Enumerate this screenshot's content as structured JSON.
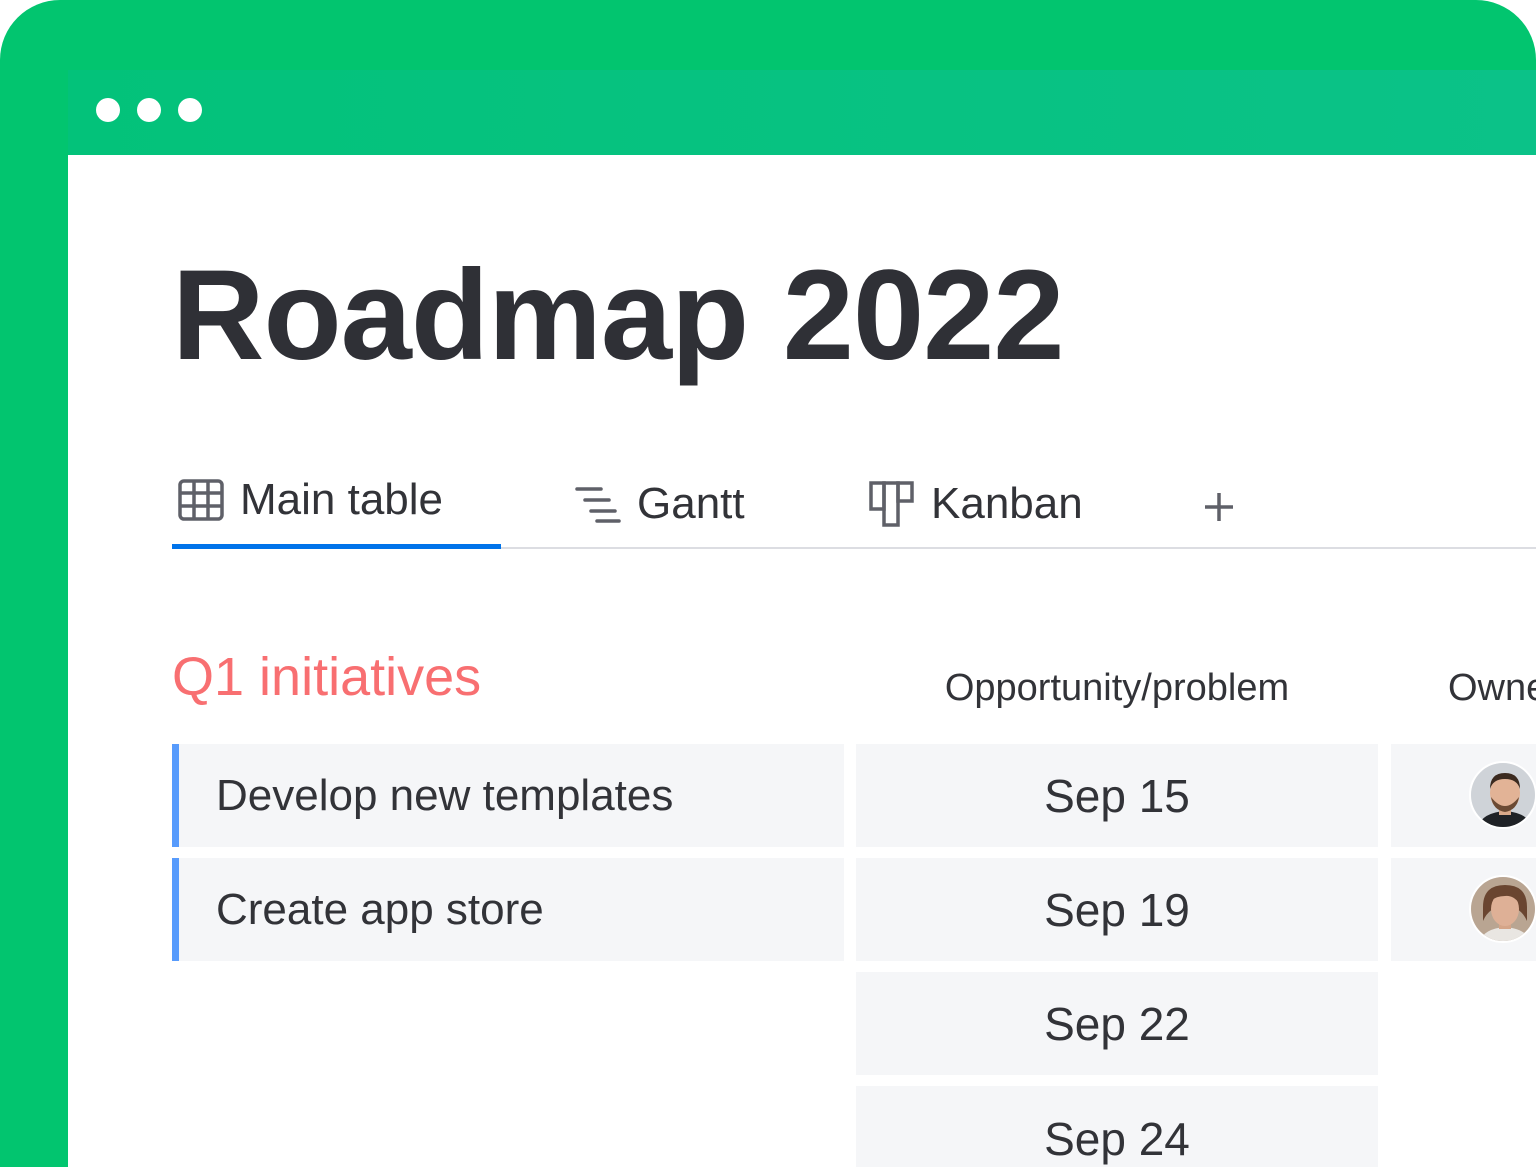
{
  "window": {
    "accent": "#02c56f",
    "dots": [
      "dot",
      "dot",
      "dot"
    ]
  },
  "page": {
    "title": "Roadmap 2022"
  },
  "tabs": [
    {
      "label": "Main table",
      "icon": "table-icon",
      "active": true
    },
    {
      "label": "Gantt",
      "icon": "gantt-icon",
      "active": false
    },
    {
      "label": "Kanban",
      "icon": "kanban-icon",
      "active": false
    }
  ],
  "add_view": {
    "label": "+",
    "icon": "plus-icon"
  },
  "group": {
    "title": "Q1 initiatives",
    "color": "#f86f71"
  },
  "columns": {
    "opportunity": "Opportunity/problem",
    "owner": "Owne"
  },
  "rows": [
    {
      "item": "Develop new templates",
      "date": "Sep 15",
      "owner": "avatar-man"
    },
    {
      "item": "Create app store",
      "date": "Sep 19",
      "owner": "avatar-woman"
    },
    {
      "item": "",
      "date": "Sep 22",
      "owner": ""
    },
    {
      "item": "",
      "date": "Sep 24",
      "owner": ""
    }
  ],
  "colors": {
    "active_tab": "#0073ea",
    "row_indicator": "#579bfc",
    "row_background": "#f5f6f8",
    "text": "#323338"
  }
}
